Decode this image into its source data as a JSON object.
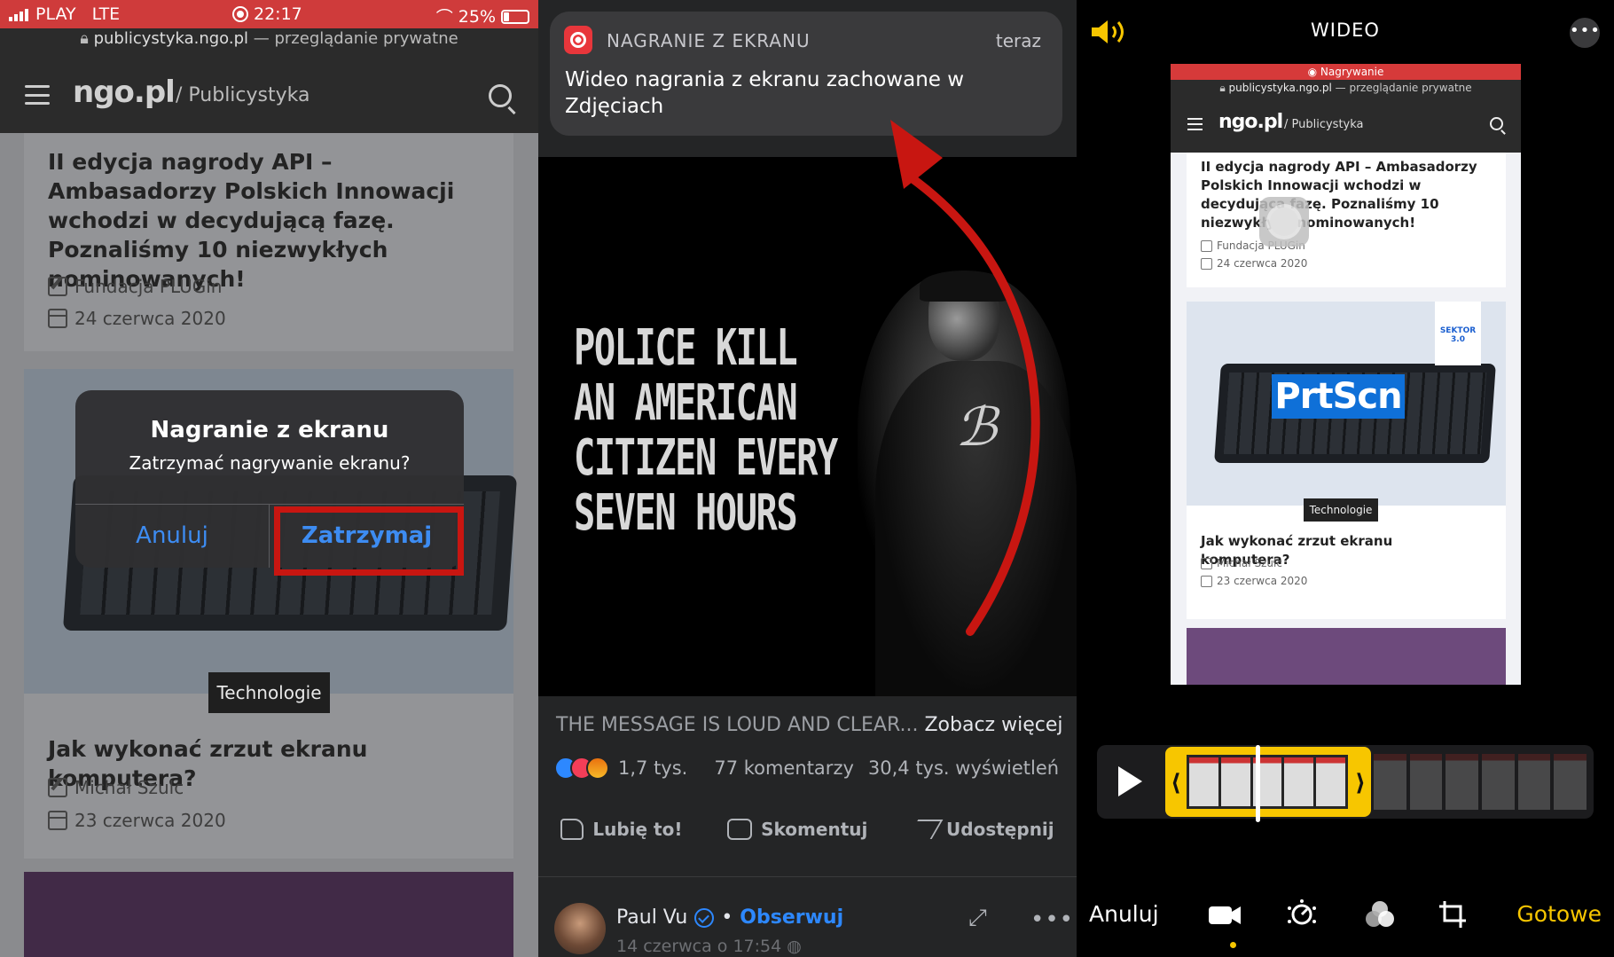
{
  "panel1": {
    "status": {
      "carrier": "PLAY",
      "network": "LTE",
      "time": "22:17",
      "battery": "25%"
    },
    "url": {
      "host": "publicystyka.ngo.pl",
      "suffix": " — przeglądanie prywatne"
    },
    "nav": {
      "logo": "ngo.pl",
      "section": "/ Publicystyka"
    },
    "article1": {
      "title": "II edycja nagrody API – Ambasadorzy Polskich Innowacji wchodzi w decydującą fazę. Poznaliśmy 10 niezwykłych nominowanych!",
      "author": "Fundacja PLUGin",
      "date": "24 czerwca 2020"
    },
    "article2": {
      "tag": "Technologie",
      "title": "Jak wykonać zrzut ekranu komputera?",
      "author": "Michał Szulc",
      "date": "23 czerwca 2020"
    },
    "alert": {
      "title": "Nagranie z ekranu",
      "message": "Zatrzymać nagrywanie ekranu?",
      "cancel": "Anuluj",
      "stop": "Zatrzymaj"
    }
  },
  "panel2": {
    "notification": {
      "app": "NAGRANIE Z EKRANU",
      "time": "teraz",
      "body": "Wideo nagrania z ekranu zachowane w Zdjęciach"
    },
    "poster_text": [
      "POLICE KILL",
      "AN AMERICAN",
      "CITIZEN EVERY",
      "SEVEN HOURS"
    ],
    "caption": {
      "text": "THE MESSAGE IS LOUD AND CLEAR...",
      "more": "Zobacz więcej"
    },
    "stats": {
      "reactions": "1,7 tys.",
      "comments": "77 komentarzy",
      "views": "30,4 tys. wyświetleń"
    },
    "actions": {
      "like": "Lubię to!",
      "comment": "Skomentuj",
      "share": "Udostępnij"
    },
    "author": {
      "name": "Paul Vu",
      "follow": "Obserwuj",
      "separator": "•",
      "date": "14 czerwca o 17:54"
    },
    "colors": {
      "arrow": "#c81611",
      "link": "#2d88ff"
    }
  },
  "panel3": {
    "title": "WIDEO",
    "phone": {
      "rec_label": "Nagrywanie",
      "url_host": "publicystyka.ngo.pl",
      "url_suffix": " — przeglądanie prywatne",
      "logo": "ngo.pl",
      "section": "/ Publicystyka",
      "article1": {
        "title": "II edycja nagrody API – Ambasadorzy Polskich Innowacji wchodzi w decydującą fazę. Poznaliśmy 10 niezwykłych nominowanych!",
        "author": "Fundacja PLUGin",
        "date": "24 czerwca 2020"
      },
      "image_text": "PrtScn",
      "badge": "SEKTOR 3.0",
      "article2": {
        "tag": "Technologie",
        "title": "Jak wykonać zrzut ekranu komputera?",
        "author": "Michał Szulc",
        "date": "23 czerwca 2020"
      }
    },
    "toolbar": {
      "cancel": "Anuluj",
      "done": "Gotowe"
    },
    "colors": {
      "accent": "#f7c600"
    }
  }
}
